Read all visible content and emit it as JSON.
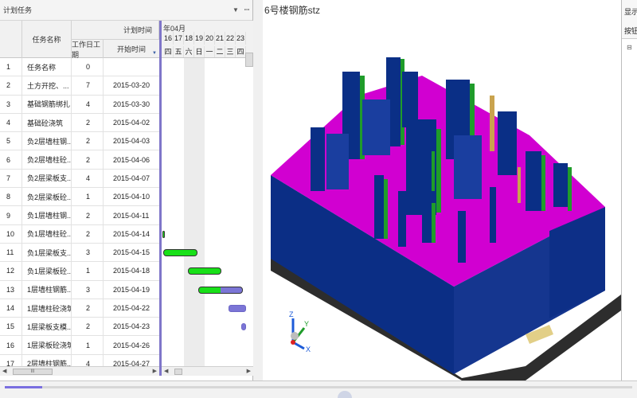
{
  "task_panel": {
    "title": "计划任务",
    "dropdown_icon": "chevron-down-icon",
    "pin_icon": "pin-icon",
    "columns": {
      "planned_time": "计划时间",
      "task_name": "任务名称",
      "duration": "工作日工期",
      "start": "开始时间"
    },
    "rows": [
      {
        "num": "1",
        "name": "任务名称",
        "duration": "0",
        "start": ""
      },
      {
        "num": "2",
        "name": "土方开挖、...",
        "duration": "7",
        "start": "2015-03-20"
      },
      {
        "num": "3",
        "name": "基础钢筋绑扎",
        "duration": "4",
        "start": "2015-03-30"
      },
      {
        "num": "4",
        "name": "基础砼浇筑",
        "duration": "2",
        "start": "2015-04-02"
      },
      {
        "num": "5",
        "name": "负2层墙柱钢...",
        "duration": "2",
        "start": "2015-04-03"
      },
      {
        "num": "6",
        "name": "负2层墙柱砼...",
        "duration": "2",
        "start": "2015-04-06"
      },
      {
        "num": "7",
        "name": "负2层梁板支...",
        "duration": "4",
        "start": "2015-04-07"
      },
      {
        "num": "8",
        "name": "负2层梁板砼...",
        "duration": "1",
        "start": "2015-04-10"
      },
      {
        "num": "9",
        "name": "负1层墙柱钢...",
        "duration": "2",
        "start": "2015-04-11"
      },
      {
        "num": "10",
        "name": "负1层墙柱砼...",
        "duration": "2",
        "start": "2015-04-14"
      },
      {
        "num": "11",
        "name": "负1层梁板支...",
        "duration": "3",
        "start": "2015-04-15"
      },
      {
        "num": "12",
        "name": "负1层梁板砼...",
        "duration": "1",
        "start": "2015-04-18"
      },
      {
        "num": "13",
        "name": "1层墙柱钢筋...",
        "duration": "3",
        "start": "2015-04-19"
      },
      {
        "num": "14",
        "name": "1层墙柱砼浇筑",
        "duration": "2",
        "start": "2015-04-22"
      },
      {
        "num": "15",
        "name": "1层梁板支模...",
        "duration": "2",
        "start": "2015-04-23"
      },
      {
        "num": "16",
        "name": "1层梁板砼浇筑",
        "duration": "1",
        "start": "2015-04-26"
      },
      {
        "num": "17",
        "name": "2层墙柱钢筋...",
        "duration": "4",
        "start": "2015-04-27"
      }
    ],
    "scroll_thumb_label": "III"
  },
  "gantt": {
    "month_label": "年04月",
    "days": [
      "16",
      "17",
      "18",
      "19",
      "20",
      "21",
      "22",
      "23"
    ],
    "weekdays": [
      "四",
      "五",
      "六",
      "日",
      "一",
      "二",
      "三",
      "四"
    ],
    "colors": {
      "done": "#18e018",
      "planned": "#7b75d6"
    },
    "bars": [
      {
        "row": 10,
        "type": "done",
        "start_day": 15.9,
        "end_day": 16.0
      },
      {
        "row": 11,
        "type": "done",
        "start_day": 16.0,
        "end_day": 19.3
      },
      {
        "row": 12,
        "type": "done",
        "start_day": 18.4,
        "end_day": 21.6
      },
      {
        "row": 13,
        "type": "mix",
        "start_day": 19.4,
        "end_day": 23.7
      },
      {
        "row": 14,
        "type": "planned",
        "start_day": 22.3,
        "end_day": 24.0
      },
      {
        "row": 15,
        "type": "planned",
        "start_day": 23.5,
        "end_day": 24.0
      }
    ]
  },
  "viewport": {
    "title": "6号楼钢筋stz",
    "axis_x": "X",
    "axis_y": "Y",
    "axis_z": "Z",
    "colors": {
      "slab": "#d400d4",
      "walls": "#0a2f86",
      "wall_side": "#1a3e9f",
      "column_green": "#1f9c2a",
      "column_tan": "#c9a34e"
    }
  },
  "right_panel": {
    "title": "显示",
    "button": "按钮",
    "tree_icon": "expand-box-icon"
  },
  "timeline": {
    "progress_fraction": 0.06
  }
}
